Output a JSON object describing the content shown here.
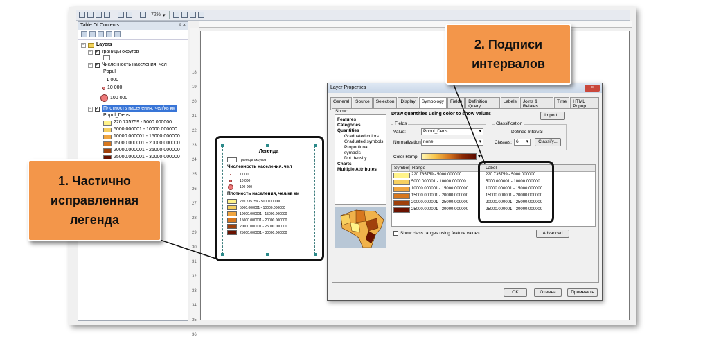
{
  "toolbar": {
    "zoom": "72%"
  },
  "toc": {
    "title": "Table Of Contents",
    "pin": "ᵖ ×",
    "root": "Layers",
    "layers": [
      {
        "name": "границы округов",
        "checked": true
      },
      {
        "name": "Численность населения, чел",
        "checked": true,
        "field": "Popul",
        "symbols": [
          "1 000",
          "10 000",
          "100 000"
        ]
      },
      {
        "name": "Плотность населения, чел/кв км",
        "checked": true,
        "selected": true,
        "field": "Popul_Dens",
        "classes": [
          "220.735759 - 5000.000000",
          "5000.000001 - 10000.000000",
          "10000.000001 - 15000.000000",
          "15000.000001 - 20000.000000",
          "20000.000001 - 25000.000000",
          "25000.000001 - 30000.000000"
        ]
      }
    ]
  },
  "ruler_numbers": [
    "18",
    "19",
    "20",
    "21",
    "22",
    "23",
    "24",
    "25",
    "26",
    "27",
    "28",
    "29",
    "30",
    "31",
    "32",
    "33",
    "34",
    "35",
    "36"
  ],
  "legend": {
    "title": "Легенда",
    "boundary_label": "границы округов",
    "population_heading": "Численность населения, чел",
    "population_symbols": [
      "1 000",
      "10 000",
      "100 000"
    ],
    "density_heading": "Плотность населения, чел/кв км",
    "density_classes": [
      "220.735759 - 5000.000000",
      "5000.000001 - 10000.000000",
      "10000.000001 - 15000.000000",
      "15000.000001 - 20000.000000",
      "20000.000001 - 25000.000000",
      "25000.000001 - 30000.000000"
    ]
  },
  "class_colors": [
    "#fff38a",
    "#f7d060",
    "#f0a540",
    "#d7771e",
    "#a0410c",
    "#6b1200"
  ],
  "callouts": {
    "left": [
      "1. Частично",
      "исправленная",
      "легенда"
    ],
    "right": [
      "2. Подписи",
      "интервалов"
    ]
  },
  "dialog": {
    "title": "Layer Properties",
    "close": "×",
    "tabs": [
      "General",
      "Source",
      "Selection",
      "Display",
      "Symbology",
      "Fields",
      "Definition Query",
      "Labels",
      "Joins & Relates",
      "Time",
      "HTML Popup"
    ],
    "active_tab": "Symbology",
    "show_label": "Show:",
    "show_items": [
      {
        "text": "Features",
        "bold": true
      },
      {
        "text": "Categories",
        "bold": true
      },
      {
        "text": "Quantities",
        "bold": true
      },
      {
        "text": "Graduated colors",
        "sub": true
      },
      {
        "text": "Graduated symbols",
        "sub": true
      },
      {
        "text": "Proportional symbols",
        "sub": true
      },
      {
        "text": "Dot density",
        "sub": true
      },
      {
        "text": "Charts",
        "bold": true
      },
      {
        "text": "Multiple Attributes",
        "bold": true
      }
    ],
    "heading": "Draw quantities using color to show values",
    "import_btn": "Import...",
    "fields_label": "Fields",
    "value_label": "Value:",
    "value": "Popul_Dens",
    "normalization_label": "Normalization:",
    "normalization": "none",
    "classification_label": "Classification",
    "classification_method": "Defined Interval",
    "classes_label": "Classes:",
    "classes_value": "6",
    "classify_btn": "Classify...",
    "color_ramp_label": "Color Ramp:",
    "table_headers": {
      "symbol": "Symbol",
      "range": "Range",
      "label": "Label"
    },
    "ranges": [
      "220.735759 - 5000.000000",
      "5000.000001 - 10000.000000",
      "10000.000001 - 15000.000000",
      "15000.000001 - 20000.000000",
      "20000.000001 - 25000.000000",
      "25000.000001 - 30000.000000"
    ],
    "labels": [
      "220.735759 - 5000.000000",
      "5000.000001 - 10000.000000",
      "10000.000001 - 15000.000000",
      "15000.000001 - 20000.000000",
      "20000.000001 - 25000.000000",
      "25000.000001 - 30000.000000"
    ],
    "show_ranges_cb": "Show class ranges using feature values",
    "advanced_btn": "Advanced",
    "ok_btn": "OK",
    "cancel_btn": "Отмена",
    "apply_btn": "Применить"
  }
}
